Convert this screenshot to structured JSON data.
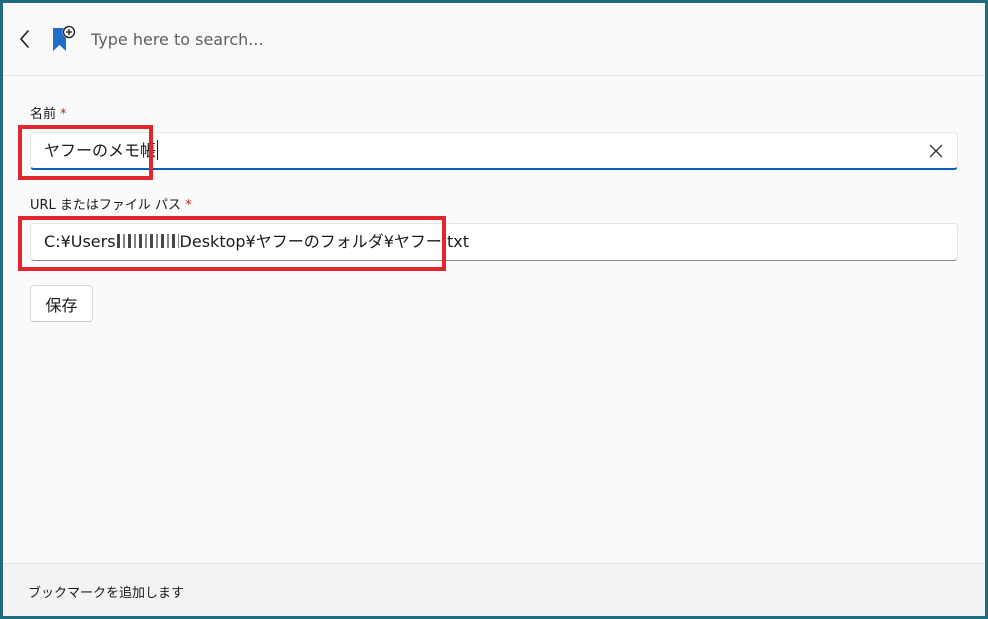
{
  "header": {
    "back_icon": "chevron-left-icon",
    "app_icon": "bookmark-add-icon",
    "search_placeholder": "Type here to search..."
  },
  "form": {
    "name": {
      "label": "名前",
      "required_mark": "*",
      "value": "ヤフーのメモ帳"
    },
    "path": {
      "label": "URL またはファイル パス",
      "required_mark": "*",
      "value_prefix": "C:¥Users",
      "value_suffix": "Desktop¥ヤフーのフォルダ¥ヤフー.txt"
    },
    "save_label": "保存"
  },
  "footer": {
    "status": "ブックマークを追加します"
  },
  "colors": {
    "accent": "#005fb8",
    "required": "#c42b1c",
    "annotation_border": "#e0262e",
    "window_border": "#1f6b7f"
  }
}
